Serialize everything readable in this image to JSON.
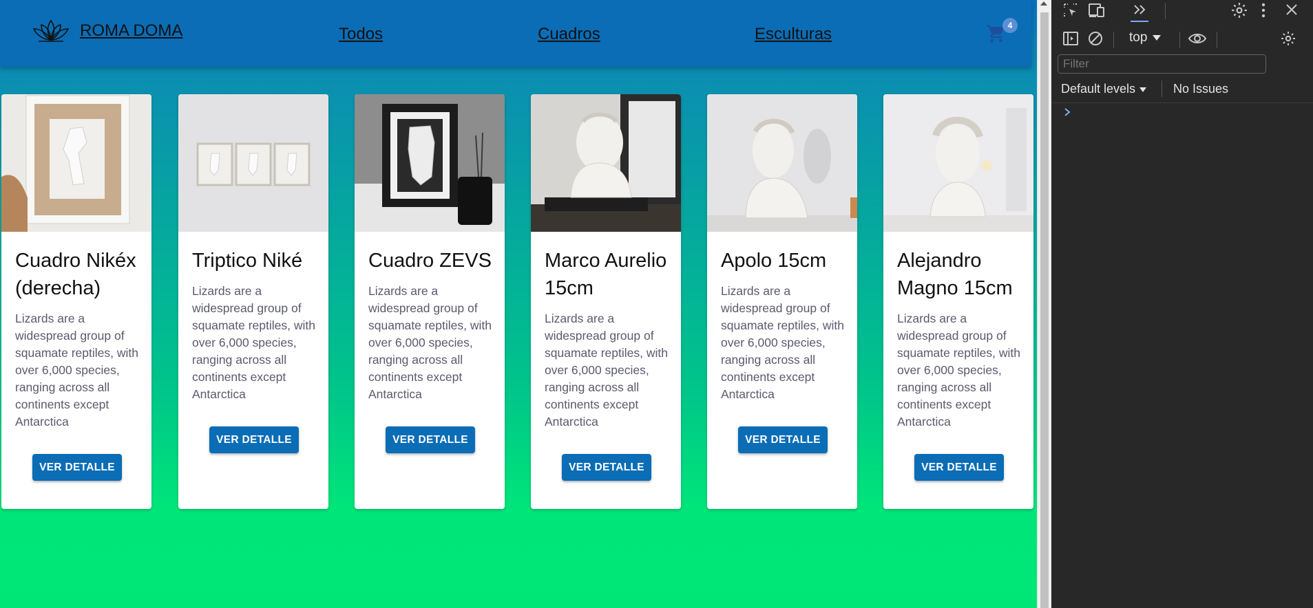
{
  "navbar": {
    "brand": "ROMA DOMA",
    "links": [
      "Todos",
      "Cuadros",
      "Esculturas"
    ],
    "cart_count": "4"
  },
  "cards": [
    {
      "title": "Cuadro Nikéx (derecha)",
      "description": "Lizards are a widespread group of squamate reptiles, with over 6,000 species, ranging across all continents except Antarctica",
      "button": "VER DETALLE"
    },
    {
      "title": "Triptico Niké",
      "description": "Lizards are a widespread group of squamate reptiles, with over 6,000 species, ranging across all continents except Antarctica",
      "button": "VER DETALLE"
    },
    {
      "title": "Cuadro ZEVS",
      "description": "Lizards are a widespread group of squamate reptiles, with over 6,000 species, ranging across all continents except Antarctica",
      "button": "VER DETALLE"
    },
    {
      "title": "Marco Aurelio 15cm",
      "description": "Lizards are a widespread group of squamate reptiles, with over 6,000 species, ranging across all continents except Antarctica",
      "button": "VER DETALLE"
    },
    {
      "title": "Apolo 15cm",
      "description": "Lizards are a widespread group of squamate reptiles, with over 6,000 species, ranging across all continents except Antarctica",
      "button": "VER DETALLE"
    },
    {
      "title": "Alejandro Magno 15cm",
      "description": "Lizards are a widespread group of squamate reptiles, with over 6,000 species, ranging across all continents except Antarctica",
      "button": "VER DETALLE"
    }
  ],
  "devtools": {
    "context": "top",
    "filter_placeholder": "Filter",
    "levels": "Default levels",
    "issues": "No Issues"
  },
  "colors": {
    "navbar": "#0a6db6",
    "button": "#0a6db6",
    "gradient_bottom": "#00e676"
  }
}
